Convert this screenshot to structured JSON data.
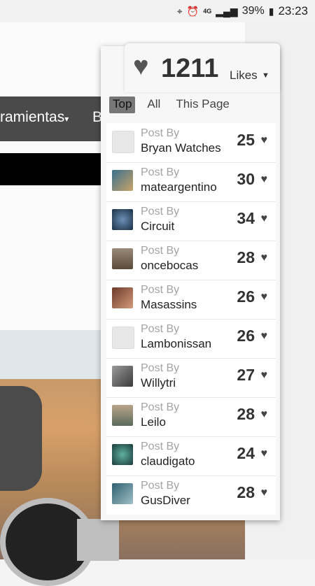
{
  "status": {
    "network": "4G",
    "battery": "39%",
    "time": "23:23"
  },
  "page": {
    "nav_item_1": "ramientas",
    "nav_item_2": "B"
  },
  "likes": {
    "total": "1211",
    "label": "Likes",
    "tabs": [
      {
        "label": "Top",
        "active": true
      },
      {
        "label": "All",
        "active": false
      },
      {
        "label": "This Page",
        "active": false
      }
    ],
    "entries": [
      {
        "post_by": "Post By",
        "user": "Bryan Watches",
        "count": "25",
        "avatar_color": "#e7e7e7"
      },
      {
        "post_by": "Post By",
        "user": "mateargentino",
        "count": "30",
        "avatar_color": "#3a6f8c"
      },
      {
        "post_by": "Post By",
        "user": "Circuit",
        "count": "34",
        "avatar_color": "#6b8fb5"
      },
      {
        "post_by": "Post By",
        "user": "oncebocas",
        "count": "28",
        "avatar_color": "#7c6b5a"
      },
      {
        "post_by": "Post By",
        "user": "Masassins",
        "count": "26",
        "avatar_color": "#a2593e"
      },
      {
        "post_by": "Post By",
        "user": "Lambonissan",
        "count": "26",
        "avatar_color": "#e7e7e7"
      },
      {
        "post_by": "Post By",
        "user": "Willytri",
        "count": "27",
        "avatar_color": "#6f6f6f"
      },
      {
        "post_by": "Post By",
        "user": "Leilo",
        "count": "28",
        "avatar_color": "#8a7a6a"
      },
      {
        "post_by": "Post By",
        "user": "claudigato",
        "count": "24",
        "avatar_color": "#2f6f6a"
      },
      {
        "post_by": "Post By",
        "user": "GusDiver",
        "count": "28",
        "avatar_color": "#4f6f8a"
      }
    ]
  }
}
